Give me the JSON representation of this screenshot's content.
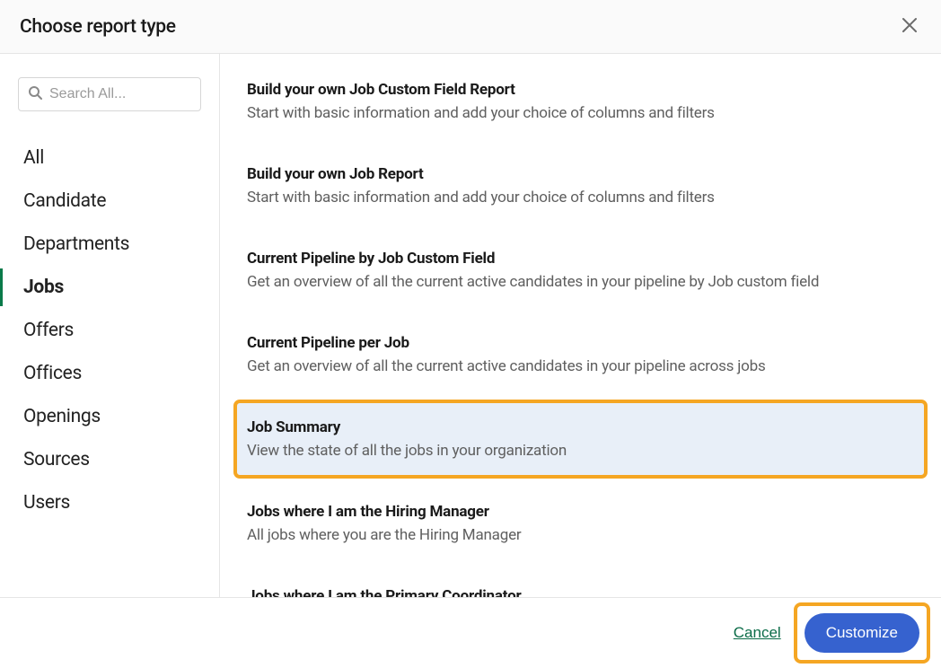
{
  "header": {
    "title": "Choose report type"
  },
  "search": {
    "placeholder": "Search All..."
  },
  "sidebar": {
    "items": [
      {
        "label": "All"
      },
      {
        "label": "Candidate"
      },
      {
        "label": "Departments"
      },
      {
        "label": "Jobs",
        "active": true
      },
      {
        "label": "Offers"
      },
      {
        "label": "Offices"
      },
      {
        "label": "Openings"
      },
      {
        "label": "Sources"
      },
      {
        "label": "Users"
      }
    ]
  },
  "reports": [
    {
      "title": "Build your own Job Custom Field Report",
      "desc": "Start with basic information and add your choice of columns and filters"
    },
    {
      "title": "Build your own Job Report",
      "desc": "Start with basic information and add your choice of columns and filters"
    },
    {
      "title": "Current Pipeline by Job Custom Field",
      "desc": "Get an overview of all the current active candidates in your pipeline by Job custom field"
    },
    {
      "title": "Current Pipeline per Job",
      "desc": "Get an overview of all the current active candidates in your pipeline across jobs"
    },
    {
      "title": "Job Summary",
      "desc": "View the state of all the jobs in your organization",
      "highlighted": true
    },
    {
      "title": "Jobs where I am the Hiring Manager",
      "desc": "All jobs where you are the Hiring Manager"
    },
    {
      "title": "Jobs where I am the Primary Coordinator",
      "desc": ""
    }
  ],
  "footer": {
    "cancel": "Cancel",
    "customize": "Customize"
  }
}
